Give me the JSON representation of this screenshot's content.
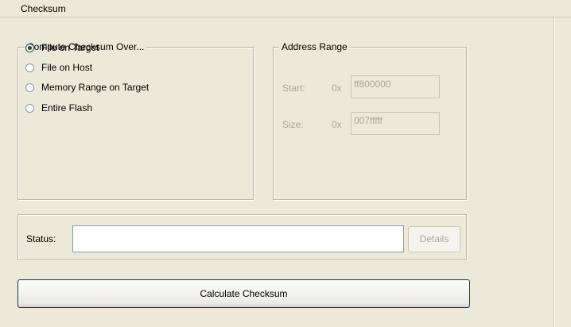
{
  "panel": {
    "title": "Checksum"
  },
  "compute": {
    "legend": "Compute Checksum Over...",
    "options": [
      {
        "label": "File on Target",
        "selected": true
      },
      {
        "label": "File on Host",
        "selected": false
      },
      {
        "label": "Memory Range on Target",
        "selected": false
      },
      {
        "label": "Entire Flash",
        "selected": false
      }
    ]
  },
  "address": {
    "legend": "Address Range",
    "start_label": "Start:",
    "start_prefix": "0x",
    "start_value": "ff800000",
    "size_label": "Size:",
    "size_prefix": "0x",
    "size_value": "007fffff"
  },
  "status": {
    "label": "Status:",
    "value": "",
    "details_label": "Details"
  },
  "actions": {
    "calculate_label": "Calculate Checksum"
  }
}
